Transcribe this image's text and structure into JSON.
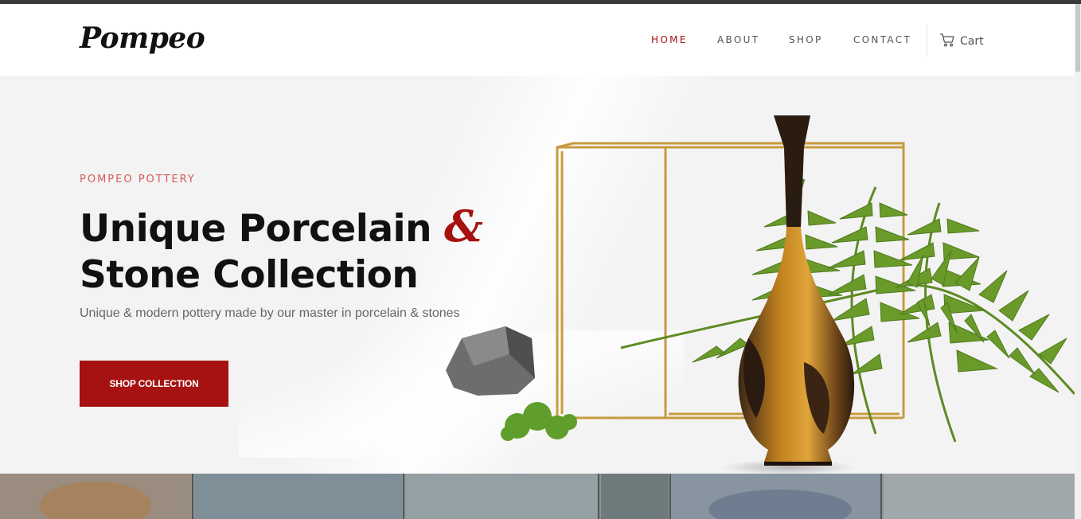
{
  "brand": {
    "logo_text": "Pompeo"
  },
  "nav": {
    "items": [
      {
        "label": "HOME",
        "active": true
      },
      {
        "label": "ABOUT",
        "active": false
      },
      {
        "label": "SHOP",
        "active": false
      },
      {
        "label": "CONTACT",
        "active": false
      }
    ],
    "cart_label": "Cart",
    "cart_icon": "shopping-cart-icon"
  },
  "hero": {
    "eyebrow": "POMPEO POTTERY",
    "headline_line1": "Unique Porcelain ",
    "headline_amp": "&",
    "headline_line2": "Stone Collection",
    "subtitle": "Unique & modern pottery made by our master in porcelain & stones",
    "cta_label": "SHOP COLLECTION"
  },
  "colors": {
    "accent": "#a61212",
    "eyebrow": "#d45a5a",
    "nav_text": "#555555",
    "hero_bg": "#f3f3f3"
  }
}
